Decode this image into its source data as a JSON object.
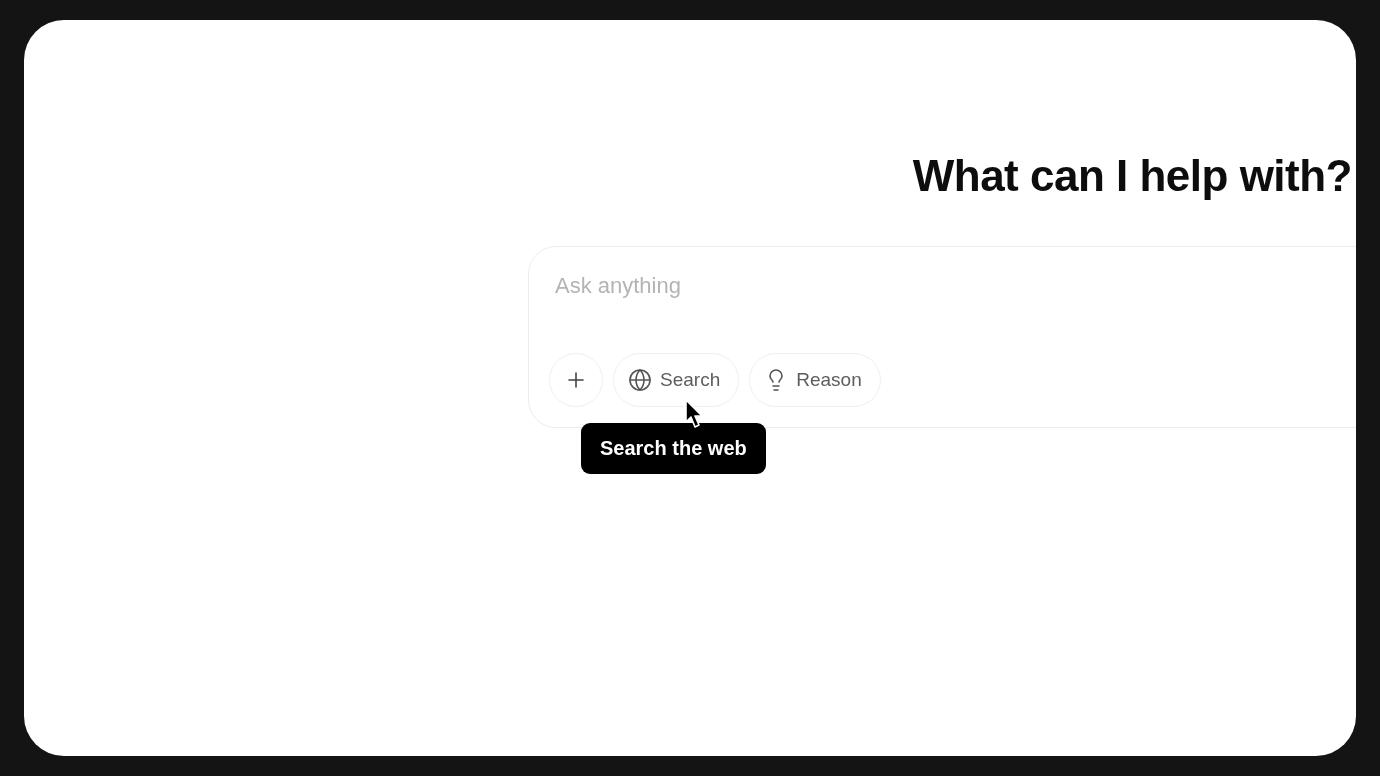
{
  "heading": "What can I help with?",
  "composer": {
    "placeholder": "Ask anything",
    "tools": [
      {
        "kind": "add"
      },
      {
        "kind": "search",
        "label": "Search"
      },
      {
        "kind": "reason",
        "label": "Reason"
      }
    ]
  },
  "tooltip": "Search the web"
}
